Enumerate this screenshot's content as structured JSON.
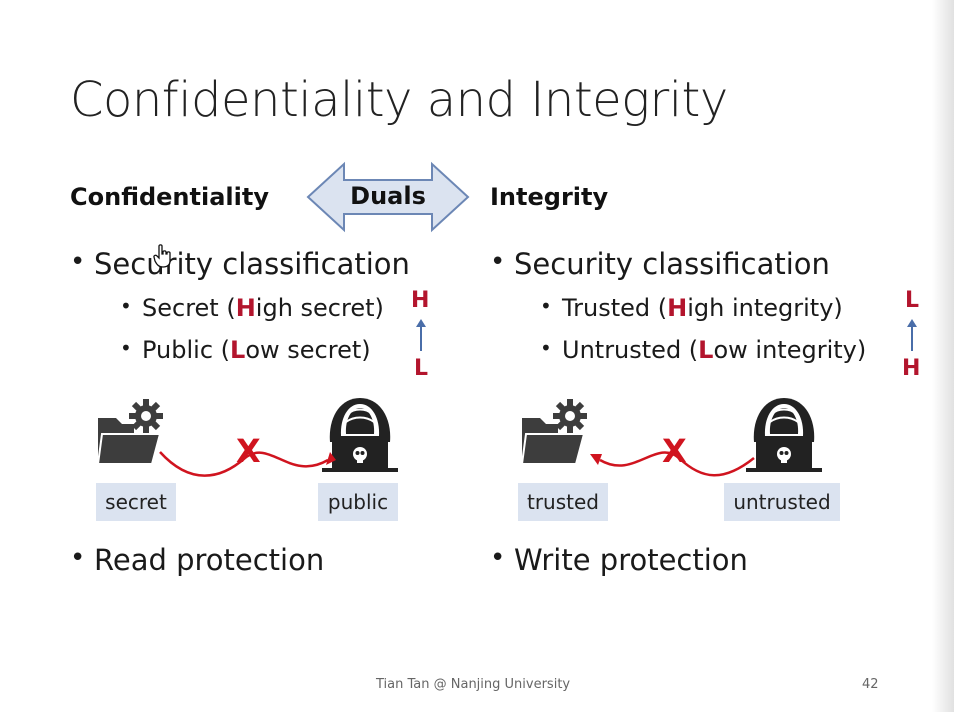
{
  "slide": {
    "title": "Confidentiality and Integrity",
    "footer": "Tian Tan @ Nanjing University",
    "page_number": "42"
  },
  "dual_arrow": {
    "label": "Duals"
  },
  "left": {
    "heading": "Confidentiality",
    "bullet1": "Security classification",
    "sub1_pre": "Secret (",
    "sub1_hl": "H",
    "sub1_post": "igh secret)",
    "sub2_pre": "Public (",
    "sub2_hl": "L",
    "sub2_post": "ow secret)",
    "level_top": "H",
    "level_bottom": "L",
    "tag_left": "secret",
    "tag_right": "public",
    "blocked_mark": "X",
    "bullet2": "Read protection"
  },
  "right": {
    "heading": "Integrity",
    "bullet1": "Security classification",
    "sub1_pre": "Trusted (",
    "sub1_hl": "H",
    "sub1_post": "igh integrity)",
    "sub2_pre": "Untrusted (",
    "sub2_hl": "L",
    "sub2_post": "ow integrity)",
    "level_top": "L",
    "level_bottom": "H",
    "tag_left": "trusted",
    "tag_right": "untrusted",
    "blocked_mark": "X",
    "bullet2": "Write protection"
  },
  "colors": {
    "accent_red": "#b3152d",
    "arrow_blue": "#4a6ea9",
    "dual_fill": "#dbe3f0",
    "dual_stroke": "#6c87b5",
    "tag_bg": "#dbe3f0"
  },
  "icons": [
    "folder-gear-icon",
    "hacker-icon",
    "skull-icon",
    "hand-cursor-icon"
  ]
}
